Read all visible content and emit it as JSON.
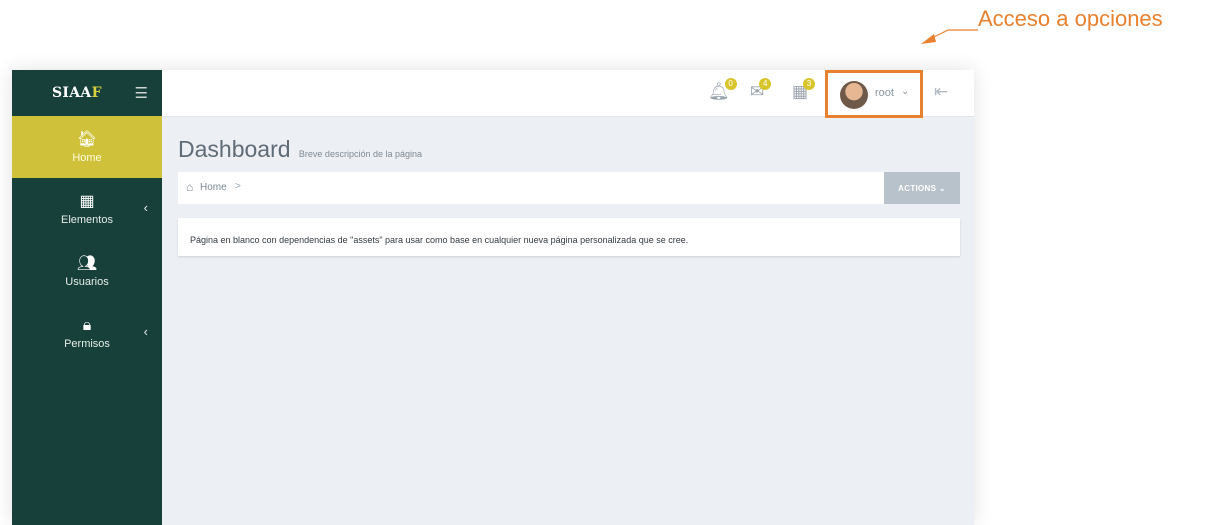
{
  "annotation": {
    "text": "Acceso a opciones"
  },
  "app": {
    "brand_prefix": "SIAA",
    "brand_accent": "F"
  },
  "sidebar": {
    "items": [
      {
        "label": "Home",
        "icon": "home-icon",
        "active": true
      },
      {
        "label": "Elementos",
        "icon": "building-icon"
      },
      {
        "label": "Usuarios",
        "icon": "users-icon"
      },
      {
        "label": "Permisos",
        "icon": "lock-icon"
      }
    ]
  },
  "topbar": {
    "notifications": {
      "badge": "0",
      "icon": "bell-icon"
    },
    "messages": {
      "badge": "4",
      "icon": "envelope-icon"
    },
    "tasks": {
      "badge": "3",
      "icon": "calendar-icon"
    },
    "user": {
      "name": "root",
      "icon": "avatar"
    },
    "logout": {
      "icon": "logout-icon"
    }
  },
  "page": {
    "title": "Dashboard",
    "subtitle": "Breve descripción de la página",
    "breadcrumb": {
      "home": "Home",
      "separator": ">"
    },
    "actions_label": "ACTIONS",
    "notice": "Página en blanco con dependencias de \"assets\" para usar como base en cualquier nueva página personalizada que se cree."
  },
  "colors": {
    "sidebar": "#17403a",
    "accent": "#cfc23a",
    "annotation": "#e8812f"
  }
}
